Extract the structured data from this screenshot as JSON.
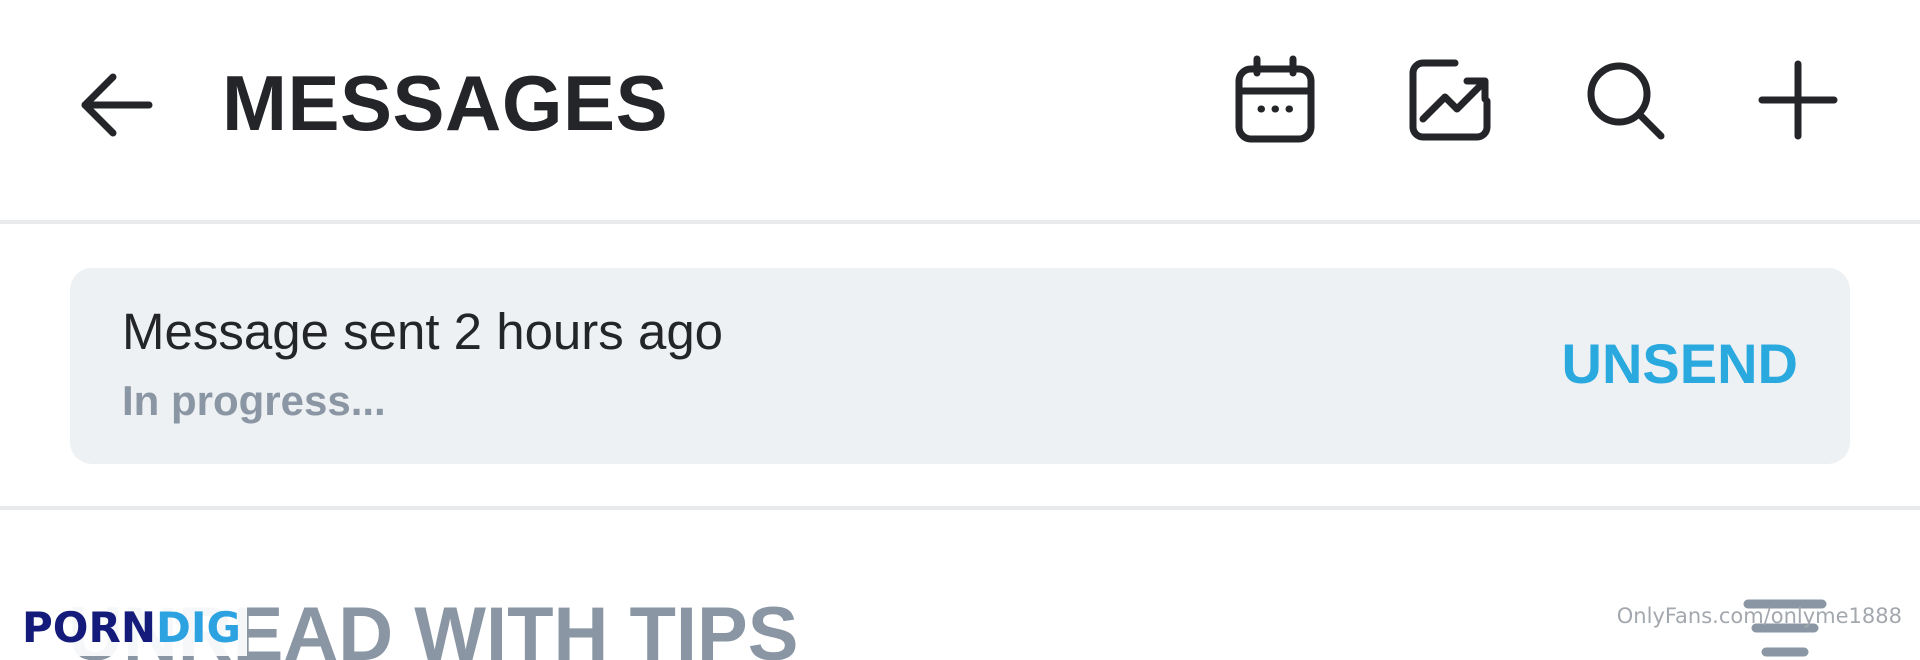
{
  "header": {
    "title": "MESSAGES",
    "icons": [
      "arrow-left-icon",
      "calendar-icon",
      "chart-icon",
      "search-icon",
      "plus-icon"
    ]
  },
  "banner": {
    "title": "Message sent 2 hours ago",
    "status": "In progress...",
    "action_label": "UNSEND"
  },
  "section": {
    "title": "UNREAD WITH TIPS"
  },
  "watermark": {
    "logo_part1": "PORN",
    "logo_part2": "DIG",
    "credit": "OnlyFans.com/onlyme1888"
  },
  "colors": {
    "text": "#242529",
    "muted": "#8a96a3",
    "accent": "#2aa9df",
    "banner_bg": "#eef1f3",
    "divider": "#e9eaec"
  }
}
